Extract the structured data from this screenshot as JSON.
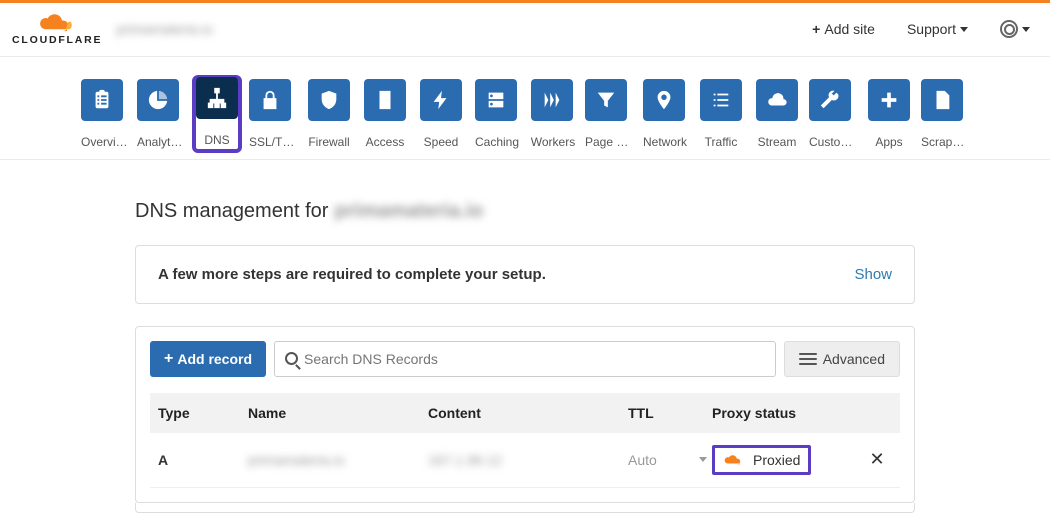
{
  "header": {
    "brand": "CLOUDFLARE",
    "site_name_blurred": "primamateria.io",
    "add_site": "Add site",
    "support": "Support"
  },
  "nav": {
    "items": [
      {
        "label": "Overview",
        "icon": "clipboard"
      },
      {
        "label": "Analytics",
        "icon": "pie"
      },
      {
        "label": "DNS",
        "icon": "sitemap",
        "active": true,
        "highlight": true
      },
      {
        "label": "SSL/TLS",
        "icon": "lock"
      },
      {
        "label": "Firewall",
        "icon": "shield"
      },
      {
        "label": "Access",
        "icon": "door"
      },
      {
        "label": "Speed",
        "icon": "bolt"
      },
      {
        "label": "Caching",
        "icon": "drive"
      },
      {
        "label": "Workers",
        "icon": "workers"
      },
      {
        "label": "Page Rules",
        "icon": "funnel"
      },
      {
        "label": "Network",
        "icon": "pin"
      },
      {
        "label": "Traffic",
        "icon": "list"
      },
      {
        "label": "Stream",
        "icon": "cloud"
      },
      {
        "label": "Custom P…",
        "icon": "wrench"
      },
      {
        "label": "Apps",
        "icon": "plus"
      },
      {
        "label": "Scrape S…",
        "icon": "doc"
      }
    ]
  },
  "page": {
    "title_prefix": "DNS management for",
    "title_domain_blurred": "primamateria.io"
  },
  "info_banner": {
    "message": "A few more steps are required to complete your setup.",
    "action": "Show"
  },
  "controls": {
    "add_record": "Add record",
    "search_placeholder": "Search DNS Records",
    "advanced": "Advanced"
  },
  "table": {
    "headers": {
      "type": "Type",
      "name": "Name",
      "content": "Content",
      "ttl": "TTL",
      "proxy": "Proxy status"
    },
    "rows": [
      {
        "type": "A",
        "name_blurred": "primamateria.io",
        "content_blurred": "167.1.96.12",
        "ttl": "Auto",
        "proxy_status": "Proxied",
        "highlight_proxy": true
      }
    ]
  }
}
